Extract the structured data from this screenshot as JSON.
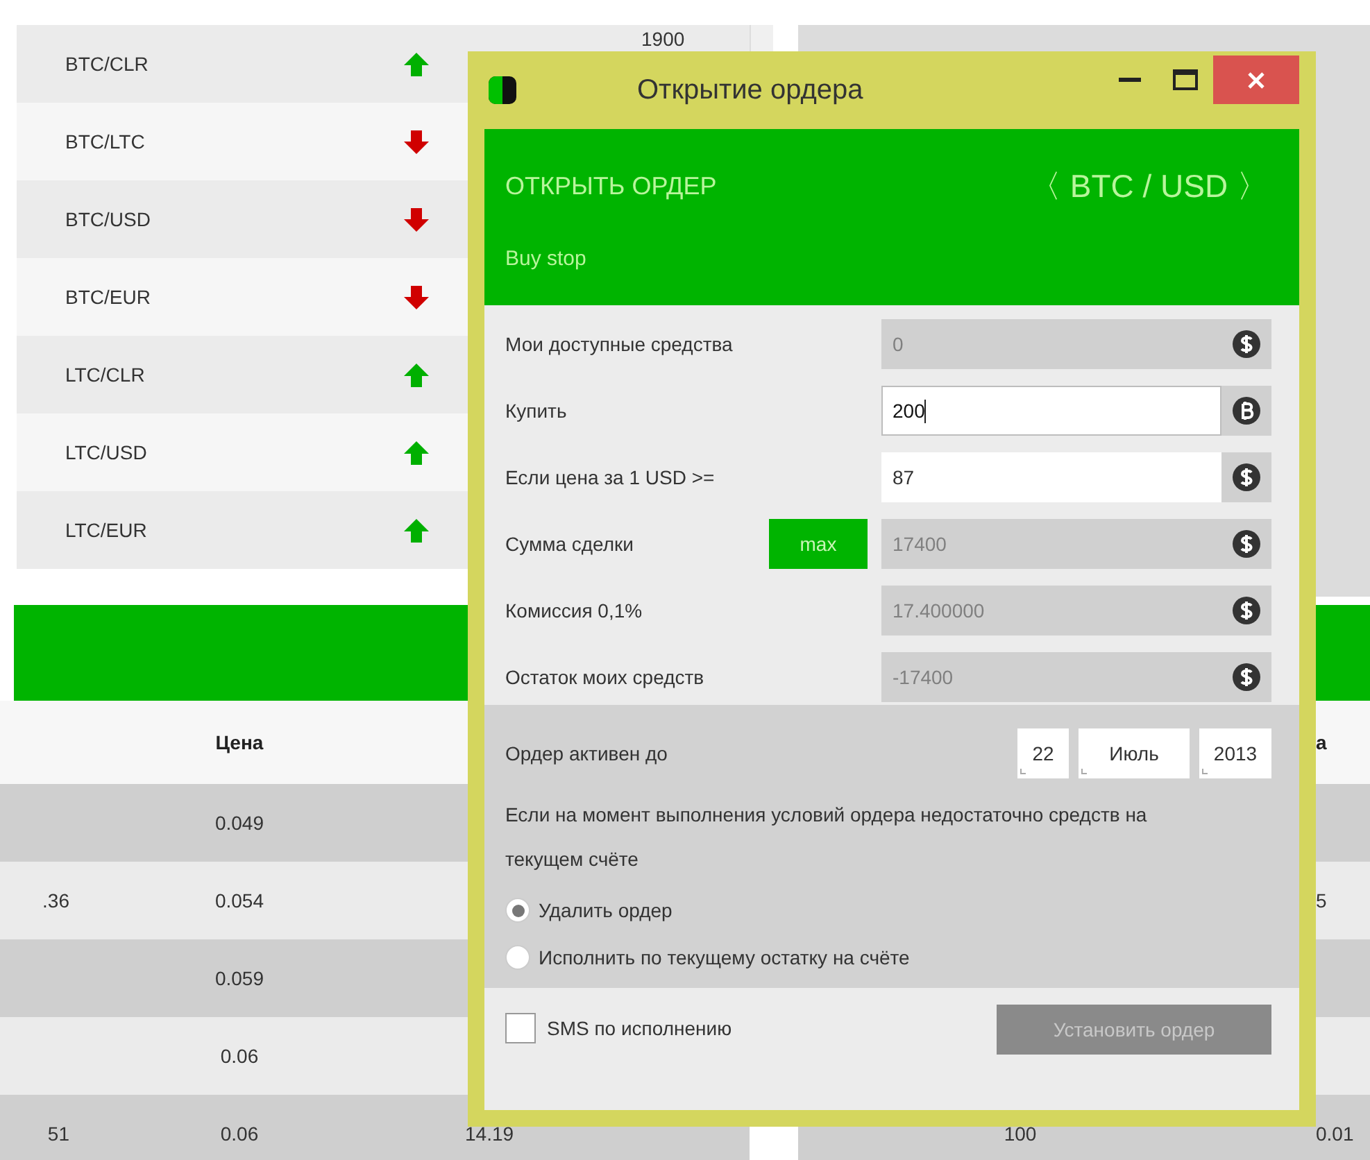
{
  "pair_list": [
    {
      "pair": "BTC/CLR",
      "rising": true,
      "value": "1900"
    },
    {
      "pair": "BTC/LTC",
      "rising": false
    },
    {
      "pair": "BTC/USD",
      "rising": false
    },
    {
      "pair": "BTC/EUR",
      "rising": false
    },
    {
      "pair": "LTC/CLR",
      "rising": true
    },
    {
      "pair": "LTC/USD",
      "rising": true
    },
    {
      "pair": "LTC/EUR",
      "rising": true
    }
  ],
  "bottom_table": {
    "header": {
      "price": "Цена",
      "column_5": "а"
    },
    "rows": [
      {
        "price": "0.049"
      },
      {
        "column_1": ".36",
        "price": "0.054",
        "column_5": "5"
      },
      {
        "price": "0.059"
      },
      {
        "price": "0.06"
      },
      {
        "column_1": "51",
        "price": "0.06",
        "column_3": "14.19",
        "column_4": "100",
        "column_5": "0.01"
      }
    ]
  },
  "dialog": {
    "title": "Открытие ордера",
    "header": {
      "heading": "ОТКРЫТЬ ОРДЕР",
      "pair": "〈 BTC / USD 〉",
      "order_type": "Buy stop"
    },
    "fields": [
      {
        "label": "Мои доступные средства",
        "value": "0",
        "kind": "dollar",
        "editable": false
      },
      {
        "label": "Купить",
        "value": "200",
        "kind": "bitcoin",
        "editable": true,
        "focused": true
      },
      {
        "label": "Если цена за 1 USD  >=",
        "value": "87",
        "kind": "dollar",
        "editable": true,
        "focused": false
      },
      {
        "label": "Сумма сделки",
        "value": "17400",
        "kind": "dollar",
        "editable": false,
        "max_button": "max"
      },
      {
        "label": "Комиссия 0,1%",
        "value": "17.400000",
        "kind": "dollar",
        "editable": false
      },
      {
        "label": "Остаток моих средств",
        "value": "-17400",
        "kind": "dollar",
        "editable": false
      }
    ],
    "expiry": {
      "label": "Ордер активен до",
      "day": "22",
      "month": "Июль",
      "year": "2013"
    },
    "note": "Если на момент выполнения условий ордера недостаточно средств на текущем счёте",
    "options": [
      {
        "label": "Удалить ордер",
        "selected": true
      },
      {
        "label": "Исполнить по текущему остатку на счёте",
        "selected": false
      }
    ],
    "sms": {
      "label": "SMS по исполнению",
      "checked": false
    },
    "submit": {
      "label": "Установить ордер",
      "disabled": true
    }
  }
}
